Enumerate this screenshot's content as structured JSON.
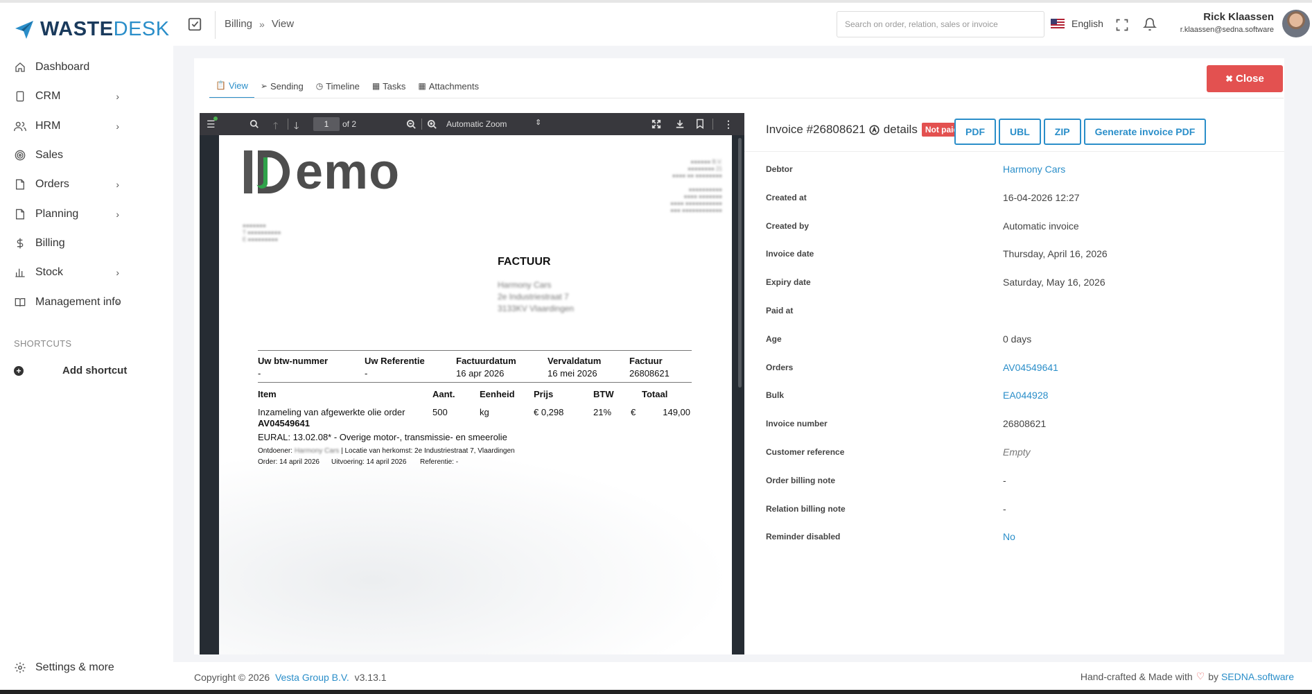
{
  "brand": {
    "name_part1": "WASTE",
    "name_part2": "DESK",
    "accent": "#2a8ec9",
    "danger": "#e35150"
  },
  "sidebar": {
    "items": [
      {
        "label": "Dashboard",
        "icon": "home-icon",
        "chevron": false
      },
      {
        "label": "CRM",
        "icon": "phone-icon",
        "chevron": true
      },
      {
        "label": "HRM",
        "icon": "users-icon",
        "chevron": true
      },
      {
        "label": "Sales",
        "icon": "target-icon",
        "chevron": false
      },
      {
        "label": "Orders",
        "icon": "document-icon",
        "chevron": true
      },
      {
        "label": "Planning",
        "icon": "document-icon",
        "chevron": true
      },
      {
        "label": "Billing",
        "icon": "dollar-icon",
        "chevron": false
      },
      {
        "label": "Stock",
        "icon": "bar-chart-icon",
        "chevron": true
      },
      {
        "label": "Management info",
        "icon": "book-icon",
        "chevron": true
      }
    ],
    "shortcuts_title": "SHORTCUTS",
    "add_shortcut": "Add shortcut",
    "settings": "Settings & more"
  },
  "header": {
    "breadcrumb": [
      "Billing",
      "View"
    ],
    "search_placeholder": "Search on order, relation, sales or invoice",
    "language": "English",
    "user_name": "Rick Klaassen",
    "user_email": "r.klaassen@sedna.software"
  },
  "tabs": [
    {
      "label": "View",
      "icon": "clipboard-icon",
      "active": true
    },
    {
      "label": "Sending",
      "icon": "send-icon",
      "active": false
    },
    {
      "label": "Timeline",
      "icon": "clock-icon",
      "active": false
    },
    {
      "label": "Tasks",
      "icon": "calendar-icon",
      "active": false
    },
    {
      "label": "Attachments",
      "icon": "calendar-icon",
      "active": false
    }
  ],
  "close_label": "Close",
  "pdf": {
    "page": "1",
    "of_pages": "of 2",
    "zoom": "Automatic Zoom",
    "logo_text": "emo",
    "title": "FACTUUR",
    "head1": [
      "Uw btw-nummer",
      "Uw Referentie",
      "Factuurdatum",
      "Vervaldatum",
      "Factuur"
    ],
    "vals1": [
      "-",
      "-",
      "16 apr 2026",
      "16 mei 2026",
      "26808621"
    ],
    "head2": [
      "Item",
      "Aant.",
      "Eenheid",
      "Prijs",
      "BTW",
      "Totaal"
    ],
    "item_desc": "Inzameling van afgewerkte olie order",
    "item_order": "AV04549641",
    "item_qty": "500",
    "item_unit": "kg",
    "item_price": "€ 0,298",
    "item_vat": "21%",
    "item_cur": "€",
    "item_total": "149,00",
    "eural": "EURAL: 13.02.08* - Overige motor-, transmissie- en smeerolie",
    "ontdoener_label": "Ontdoener:",
    "ontdoener_blur": "Harmony Cars",
    "locatie": "| Locatie van herkomst: 2e Industriestraat 7, Vlaardingen",
    "order_line": "Order: 14 april 2026",
    "uitvoering": "Uitvoering: 14 april 2026",
    "referentie": "Referentie: -",
    "blur_company": "Harmony Cars",
    "blur_addr1": "2e Industriestraat 7",
    "blur_addr2": "3133KV Vlaardingen"
  },
  "details": {
    "title_prefix": "Invoice #26808621",
    "title_suffix": "details",
    "status": "Not paid",
    "buttons": [
      "PDF",
      "UBL",
      "ZIP",
      "Generate invoice PDF"
    ],
    "rows": [
      {
        "label": "Debtor",
        "value": "Harmony Cars",
        "type": "link"
      },
      {
        "label": "Created at",
        "value": "16-04-2026 12:27",
        "type": "text"
      },
      {
        "label": "Created by",
        "value": "Automatic invoice",
        "type": "text"
      },
      {
        "label": "Invoice date",
        "value": "Thursday, April 16, 2026",
        "type": "text"
      },
      {
        "label": "Expiry date",
        "value": "Saturday, May 16, 2026",
        "type": "text"
      },
      {
        "label": "Paid at",
        "value": "",
        "type": "text"
      },
      {
        "label": "Age",
        "value": "0 days",
        "type": "text"
      },
      {
        "label": "Orders",
        "value": "AV04549641",
        "type": "link"
      },
      {
        "label": "Bulk",
        "value": "EA044928",
        "type": "link"
      },
      {
        "label": "Invoice number",
        "value": "26808621",
        "type": "text"
      },
      {
        "label": "Customer reference",
        "value": "Empty",
        "type": "empty"
      },
      {
        "label": "Order billing note",
        "value": "-",
        "type": "text"
      },
      {
        "label": "Relation billing note",
        "value": "-",
        "type": "text"
      },
      {
        "label": "Reminder disabled",
        "value": "No",
        "type": "link"
      }
    ]
  },
  "footer": {
    "copyright": "Copyright © 2026",
    "company": "Vesta Group B.V.",
    "version": "v3.13.1",
    "made": "Hand-crafted & Made with",
    "by": "by",
    "vendor": "SEDNA.software"
  }
}
